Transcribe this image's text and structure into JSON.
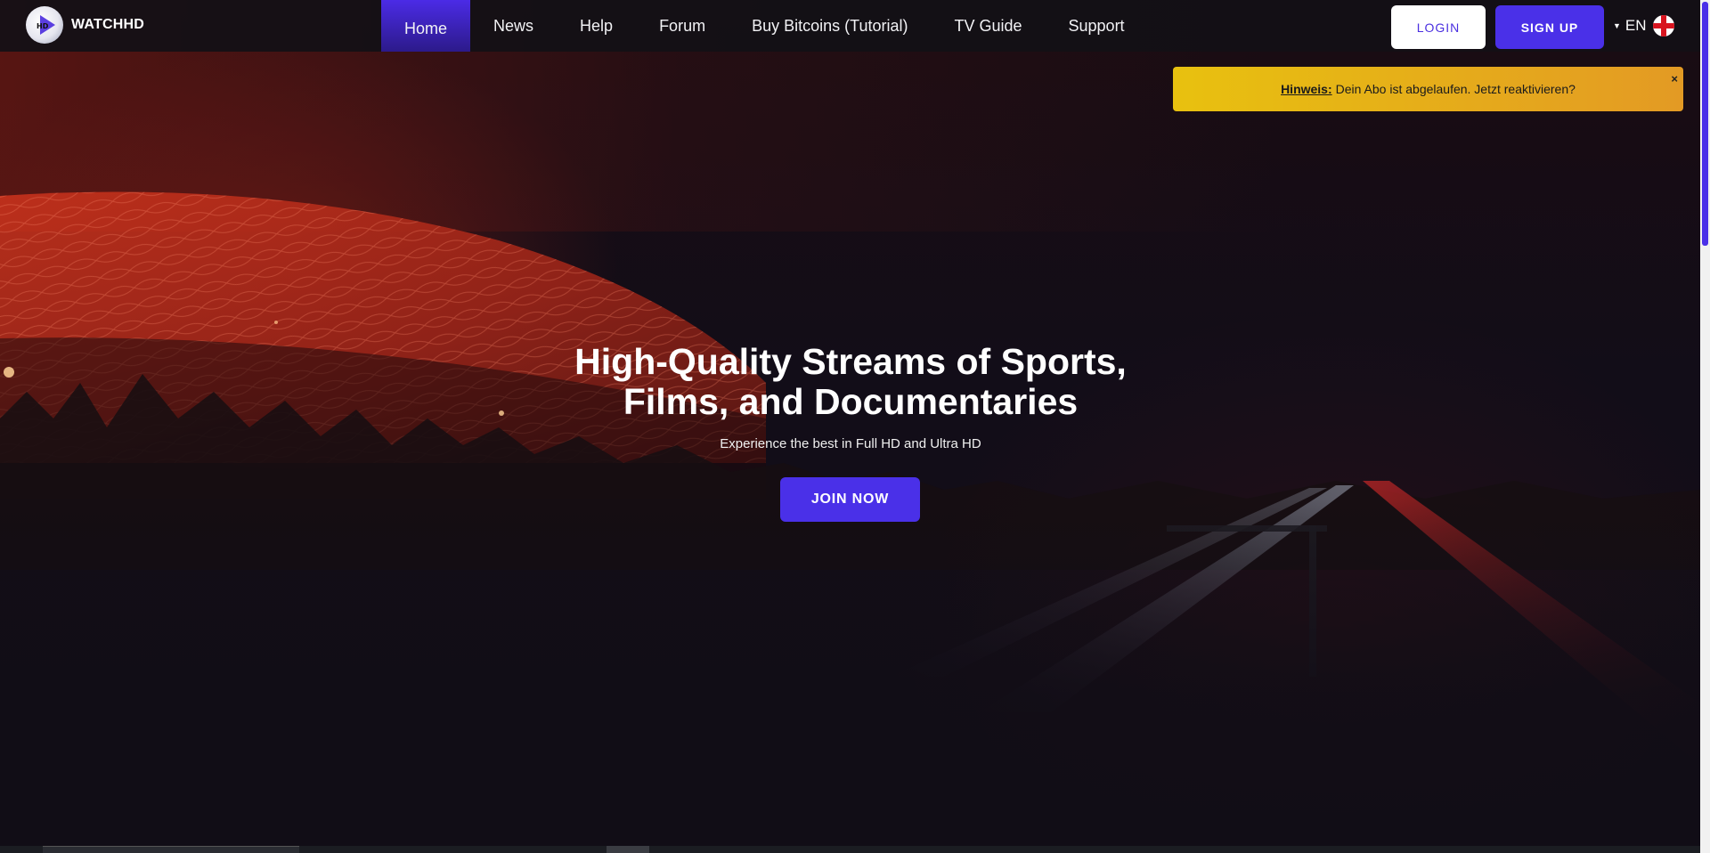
{
  "brand": {
    "name": "WATCHHD",
    "logo_badge": "HD",
    "accent": "#4a30e8"
  },
  "nav": {
    "items": [
      {
        "label": "Home",
        "active": true
      },
      {
        "label": "News"
      },
      {
        "label": "Help"
      },
      {
        "label": "Forum"
      },
      {
        "label": "Buy Bitcoins (Tutorial)"
      },
      {
        "label": "TV Guide"
      },
      {
        "label": "Support"
      }
    ]
  },
  "auth": {
    "login_label": "LOGIN",
    "signup_label": "SIGN UP"
  },
  "language": {
    "code": "EN",
    "flag": "england-flag"
  },
  "notice": {
    "strong": "Hinweis:",
    "text": "Dein Abo ist abgelaufen. Jetzt reaktivieren?",
    "close_glyph": "×",
    "colors": [
      "#e8c10f",
      "#e39a24"
    ]
  },
  "hero": {
    "headline_line1": "High-Quality Streams of Sports,",
    "headline_line2": "Films, and Documentaries",
    "subline": "Experience the best in Full HD and Ultra HD",
    "cta_label": "JOIN NOW"
  },
  "icons": [
    "play-logo-icon",
    "caret-down-icon",
    "england-flag-icon",
    "close-icon"
  ]
}
